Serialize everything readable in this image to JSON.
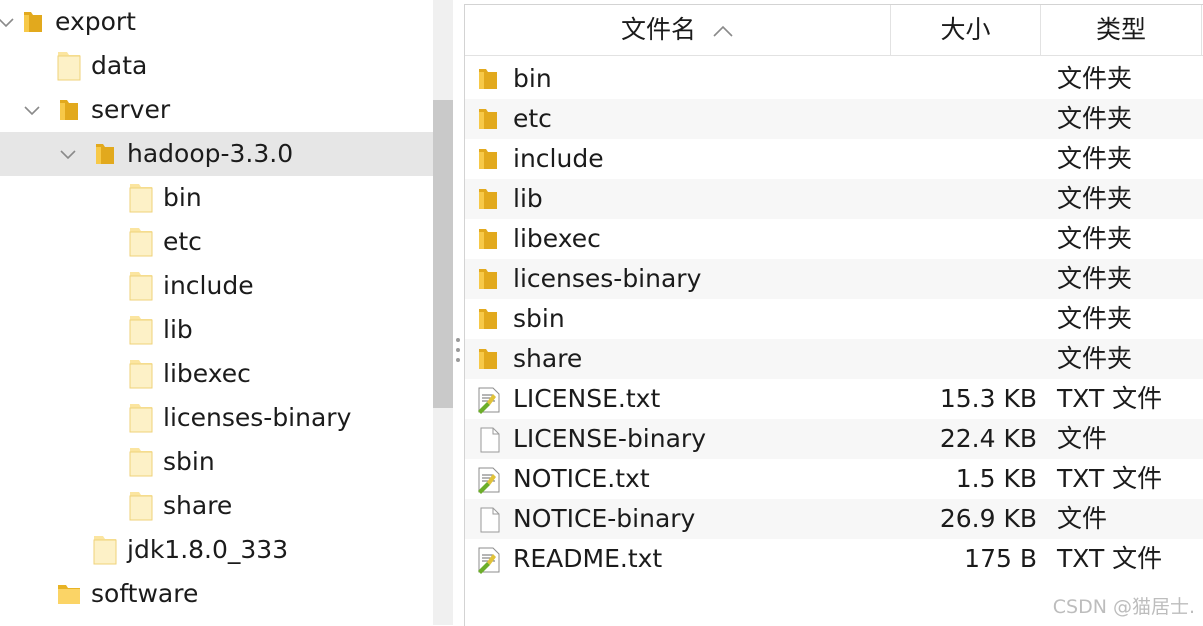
{
  "tree": {
    "items": [
      {
        "label": "export",
        "icon": "folder-open-icon",
        "expanded": true
      },
      {
        "label": "data",
        "icon": "folder-icon"
      },
      {
        "label": "server",
        "icon": "folder-open-icon",
        "expanded": true
      },
      {
        "label": "hadoop-3.3.0",
        "icon": "folder-open-icon",
        "expanded": true,
        "selected": true
      },
      {
        "label": "bin",
        "icon": "folder-icon"
      },
      {
        "label": "etc",
        "icon": "folder-icon"
      },
      {
        "label": "include",
        "icon": "folder-icon"
      },
      {
        "label": "lib",
        "icon": "folder-icon"
      },
      {
        "label": "libexec",
        "icon": "folder-icon"
      },
      {
        "label": "licenses-binary",
        "icon": "folder-icon"
      },
      {
        "label": "sbin",
        "icon": "folder-icon"
      },
      {
        "label": "share",
        "icon": "folder-icon"
      },
      {
        "label": "jdk1.8.0_333",
        "icon": "folder-icon"
      },
      {
        "label": "software",
        "icon": "folder-icon"
      }
    ]
  },
  "list": {
    "columns": {
      "name": "文件名",
      "size": "大小",
      "type": "类型"
    },
    "sort_icon": "chevron-up-icon",
    "rows": [
      {
        "name": "bin",
        "size": "",
        "type": "文件夹",
        "icon": "folder-icon"
      },
      {
        "name": "etc",
        "size": "",
        "type": "文件夹",
        "icon": "folder-icon"
      },
      {
        "name": "include",
        "size": "",
        "type": "文件夹",
        "icon": "folder-icon"
      },
      {
        "name": "lib",
        "size": "",
        "type": "文件夹",
        "icon": "folder-icon"
      },
      {
        "name": "libexec",
        "size": "",
        "type": "文件夹",
        "icon": "folder-icon"
      },
      {
        "name": "licenses-binary",
        "size": "",
        "type": "文件夹",
        "icon": "folder-icon"
      },
      {
        "name": "sbin",
        "size": "",
        "type": "文件夹",
        "icon": "folder-icon"
      },
      {
        "name": "share",
        "size": "",
        "type": "文件夹",
        "icon": "folder-icon"
      },
      {
        "name": "LICENSE.txt",
        "size": "15.3 KB",
        "type": "TXT 文件",
        "icon": "text-file-icon"
      },
      {
        "name": "LICENSE-binary",
        "size": "22.4 KB",
        "type": "文件",
        "icon": "blank-file-icon"
      },
      {
        "name": "NOTICE.txt",
        "size": "1.5 KB",
        "type": "TXT 文件",
        "icon": "text-file-icon"
      },
      {
        "name": "NOTICE-binary",
        "size": "26.9 KB",
        "type": "文件",
        "icon": "blank-file-icon"
      },
      {
        "name": "README.txt",
        "size": "175 B",
        "type": "TXT 文件",
        "icon": "text-file-icon"
      }
    ]
  },
  "watermark": "CSDN @猫居士.",
  "colors": {
    "folder": "#f7c948",
    "folder_dark": "#e2a91d",
    "selected_row": "#e6e6e6",
    "alt_row": "#f7f7f7"
  }
}
